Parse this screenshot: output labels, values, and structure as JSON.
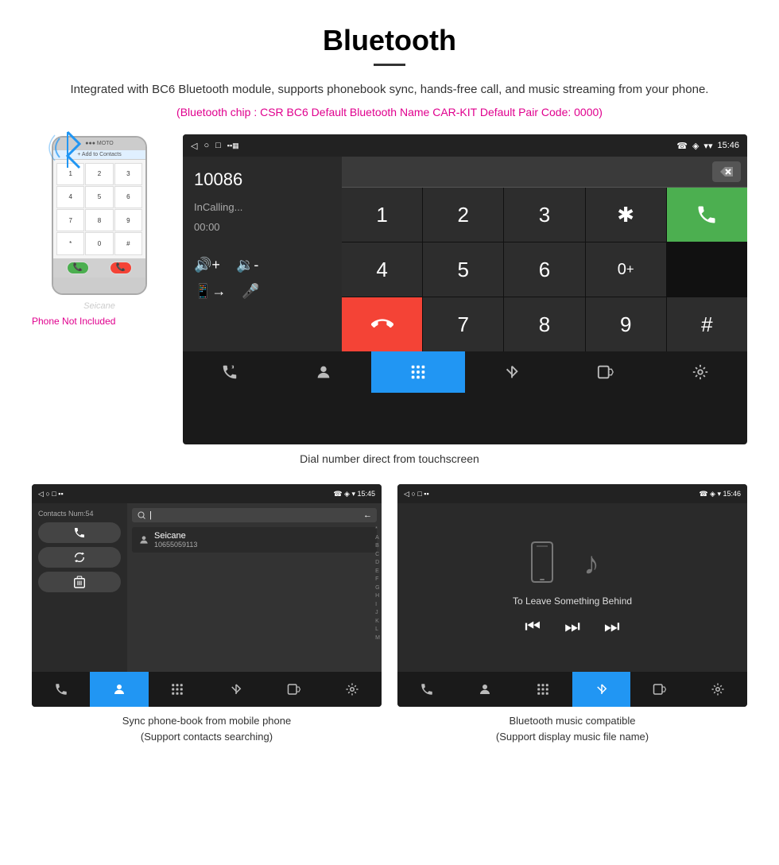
{
  "header": {
    "title": "Bluetooth",
    "subtitle": "Integrated with BC6 Bluetooth module, supports phonebook sync, hands-free call, and music streaming from your phone.",
    "bt_info": "(Bluetooth chip : CSR BC6    Default Bluetooth Name CAR-KIT    Default Pair Code: 0000)"
  },
  "dial_screen": {
    "status_bar": {
      "left_icons": [
        "◁",
        "○",
        "□",
        "▪▪"
      ],
      "right_icons": [
        "☎",
        "◈",
        "▾"
      ],
      "time": "15:46"
    },
    "number": "10086",
    "status": "InCalling...",
    "timer": "00:00",
    "numpad": [
      "1",
      "2",
      "3",
      "*",
      "📞",
      "4",
      "5",
      "6",
      "0+",
      "",
      "7",
      "8",
      "9",
      "#",
      "📞end"
    ],
    "nav_items": [
      "☎⇄",
      "👤",
      "▦",
      "✳",
      "⬚",
      "⚙"
    ]
  },
  "caption_main": "Dial number direct from touchscreen",
  "phone_not_included": "Phone Not Included",
  "seicane": "Seicane",
  "contacts_screen": {
    "status_bar": {
      "time": "15:45"
    },
    "contacts_num": "Contacts Num:54",
    "contact_name": "Seicane",
    "contact_phone": "10655059113",
    "buttons": [
      "☎",
      "↺",
      "🗑"
    ],
    "nav_items": [
      "☎⇄",
      "👤",
      "▦",
      "✳",
      "⬚",
      "⚙"
    ]
  },
  "music_screen": {
    "status_bar": {
      "time": "15:46"
    },
    "song_title": "To Leave Something Behind",
    "nav_items": [
      "☎⇄",
      "👤",
      "▦",
      "✳",
      "⬚",
      "⚙"
    ]
  },
  "caption_contacts": "Sync phone-book from mobile phone\n(Support contacts searching)",
  "caption_music": "Bluetooth music compatible\n(Support display music file name)"
}
